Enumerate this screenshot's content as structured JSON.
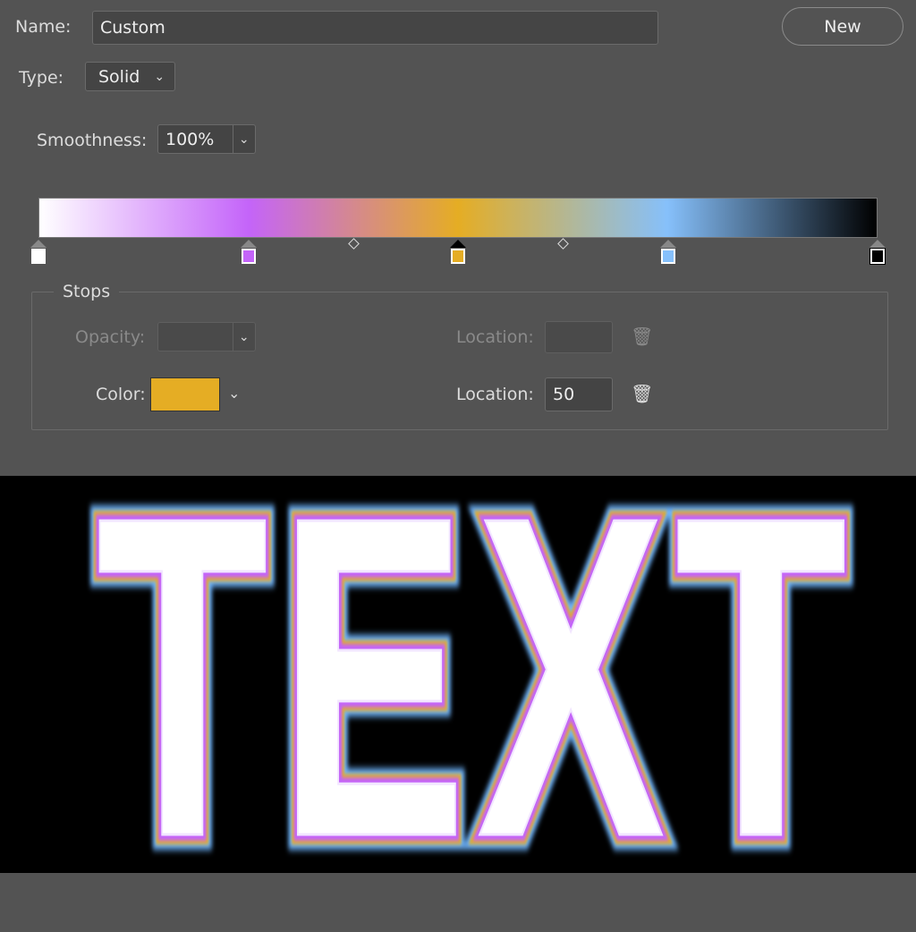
{
  "name": {
    "label": "Name:",
    "value": "Custom"
  },
  "new_button": "New",
  "type": {
    "label": "Type:",
    "value": "Solid"
  },
  "smoothness": {
    "label": "Smoothness:",
    "value": "100%"
  },
  "gradient": {
    "stops": [
      {
        "location": 0,
        "color": "#ffffff"
      },
      {
        "location": 25,
        "color": "#c464f9"
      },
      {
        "location": 50,
        "color": "#e5ad24",
        "selected": true
      },
      {
        "location": 75,
        "color": "#86c0fb"
      },
      {
        "location": 100,
        "color": "#000000"
      }
    ],
    "midpoints": [
      37.5,
      62.5
    ]
  },
  "stops_panel": {
    "title": "Stops",
    "opacity_label": "Opacity:",
    "opacity_location_label": "Location:",
    "color_label": "Color:",
    "color_value": "#e5ad24",
    "color_location_label": "Location:",
    "color_location_value": "50"
  },
  "preview": {
    "text": "TEXT"
  }
}
